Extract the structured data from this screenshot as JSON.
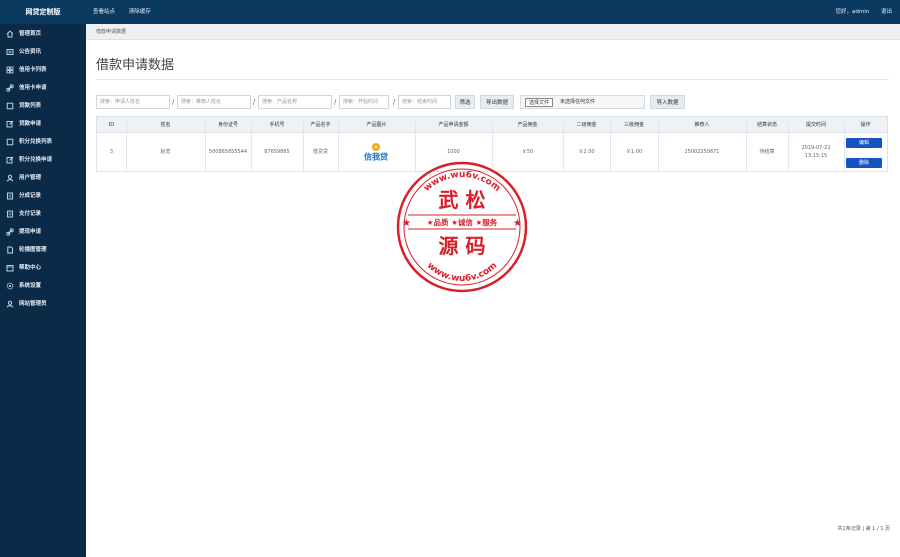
{
  "topbar": {
    "brand": "网贷定制版",
    "nav": [
      "查看站点",
      "清除缓存"
    ],
    "greeting": "您好，admin",
    "logout": "退出"
  },
  "sidebar": {
    "items": [
      {
        "label": "管理首页",
        "icon": "home-icon"
      },
      {
        "label": "公告资讯",
        "icon": "news-icon"
      },
      {
        "label": "信用卡列表",
        "icon": "grid-icon"
      },
      {
        "label": "信用卡申请",
        "icon": "link-icon"
      },
      {
        "label": "贷款列表",
        "icon": "square-icon"
      },
      {
        "label": "贷款申请",
        "icon": "edit-icon"
      },
      {
        "label": "积分兑换列表",
        "icon": "square-icon"
      },
      {
        "label": "积分兑换申请",
        "icon": "edit-icon"
      },
      {
        "label": "用户管理",
        "icon": "user-icon"
      },
      {
        "label": "分成记录",
        "icon": "doc-icon"
      },
      {
        "label": "支付记录",
        "icon": "doc-icon"
      },
      {
        "label": "提现申请",
        "icon": "link-icon"
      },
      {
        "label": "轮播图管理",
        "icon": "file-icon"
      },
      {
        "label": "帮助中心",
        "icon": "book-icon"
      },
      {
        "label": "系统设置",
        "icon": "gear-icon"
      },
      {
        "label": "网站管理员",
        "icon": "user-icon"
      }
    ]
  },
  "breadcrumb": "借款申请数据",
  "page_title": "借款申请数据",
  "filters": {
    "applicant_placeholder": "搜索：申请人姓名",
    "referrer_placeholder": "搜索：推荐人姓名",
    "product_placeholder": "搜索：产品名称",
    "start_placeholder": "搜索：开始时间",
    "end_placeholder": "搜索：结束时间",
    "filter_button": "筛选",
    "export_button": "导出数据",
    "choose_file_button": "选择文件",
    "no_file_text": "未选择任何文件",
    "import_button": "导入数据"
  },
  "table": {
    "headers": [
      "ID",
      "姓名",
      "身份证号",
      "手机号",
      "产品名字",
      "产品图片",
      "产品申请金额",
      "产品佣金",
      "二级佣金",
      "三级佣金",
      "推荐人",
      "结算状态",
      "提交时间",
      "操作"
    ],
    "rows": [
      {
        "id": "3",
        "name": "赵忠",
        "id_number": "500865855544",
        "phone": "87659865",
        "product_name": "借贷贷",
        "product_image_text": "信我贷",
        "amount": "1000",
        "commission": "￥50",
        "commission2": "￥2.00",
        "commission3": "￥1.00",
        "referrer": "15002350671",
        "status": "待结算",
        "time_date": "2019-07-22",
        "time_clock": "13:15:15",
        "action_edit": "编辑",
        "action_delete": "删除"
      }
    ]
  },
  "pager": "共1条记录 | 第 1 / 1 页",
  "watermark": {
    "url_top": "www.wu6v.com",
    "line1": "武 松",
    "slogan": "★品质 ★诚信 ★服务",
    "line2": "源 码",
    "url_bottom": "www.wu6v.com",
    "color": "#d9202a"
  }
}
